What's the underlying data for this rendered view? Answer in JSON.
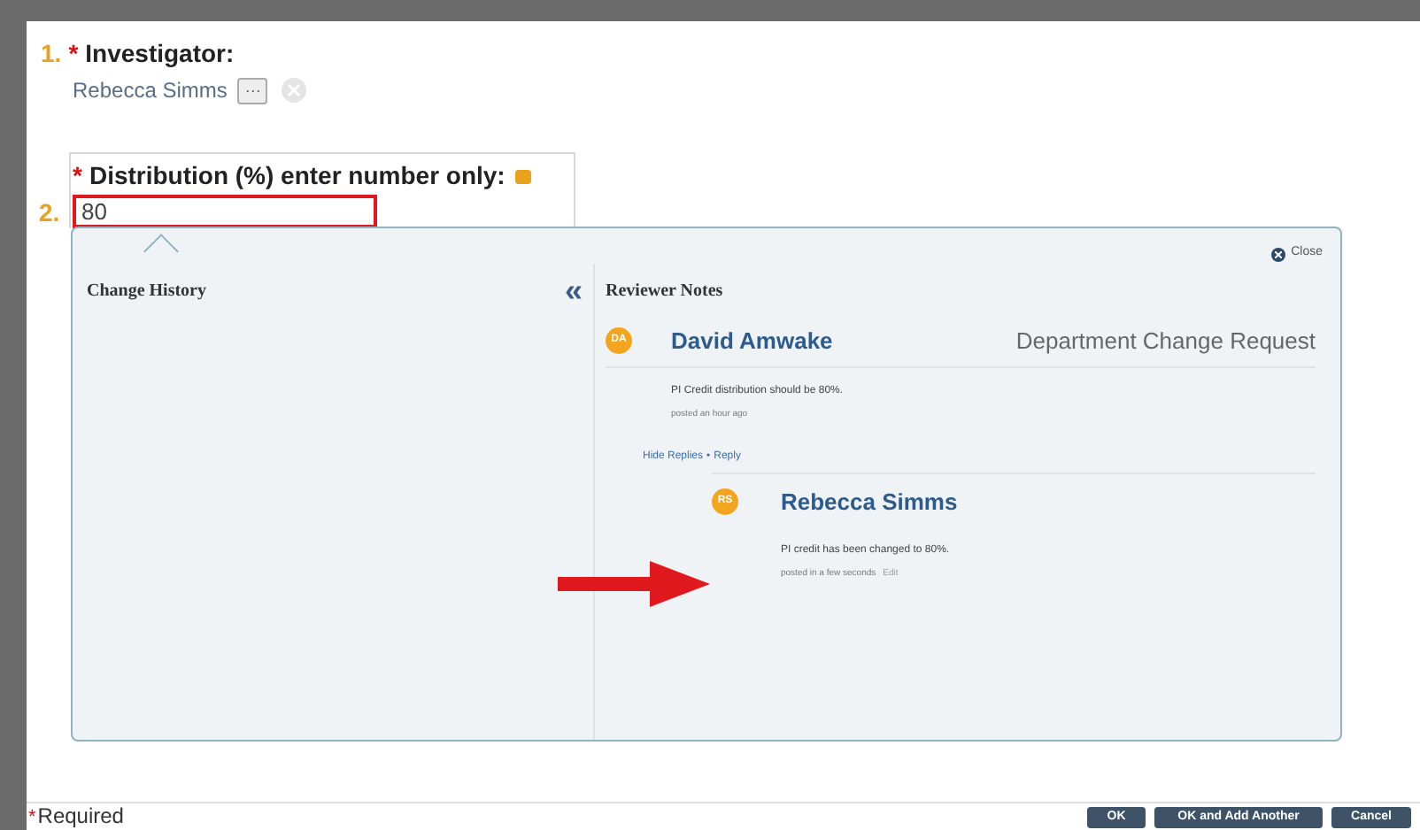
{
  "fields": [
    {
      "number": "1.",
      "required_mark": "*",
      "label": "Investigator:",
      "value": "Rebecca Simms",
      "lookup_button": "···"
    },
    {
      "number": "2.",
      "required_mark": "*",
      "label": "Distribution (%) enter number only:",
      "value": "80"
    }
  ],
  "panel": {
    "close": "Close",
    "left_title": "Change History",
    "collapse": "«",
    "right_title": "Reviewer Notes",
    "note": {
      "initials": "DA",
      "author": "David Amwake",
      "category": "Department Change Request",
      "text": "PI Credit distribution should be 80%.",
      "time": "posted an hour ago",
      "links": [
        "Hide Replies",
        "Reply"
      ],
      "separator": "•",
      "reply": {
        "initials": "RS",
        "author": "Rebecca Simms",
        "text": "PI credit has been changed to 80%.",
        "time": "posted in a few seconds",
        "edit": "Edit"
      }
    }
  },
  "footer": {
    "required_mark": "*",
    "required": "Required",
    "buttons": [
      "OK",
      "OK and Add Another",
      "Cancel"
    ]
  }
}
